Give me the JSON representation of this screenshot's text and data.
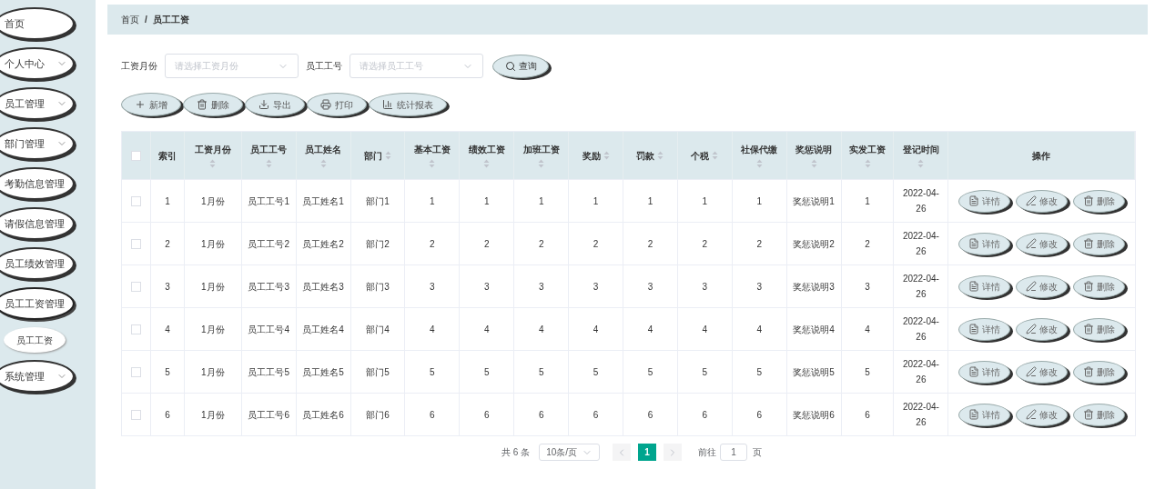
{
  "sidebar": {
    "items": [
      {
        "label": "首页",
        "collapsible": false,
        "expanded": false
      },
      {
        "label": "个人中心",
        "collapsible": true,
        "expanded": false
      },
      {
        "label": "员工管理",
        "collapsible": true,
        "expanded": false
      },
      {
        "label": "部门管理",
        "collapsible": true,
        "expanded": false
      },
      {
        "label": "考勤信息管理",
        "collapsible": false,
        "expanded": false
      },
      {
        "label": "请假信息管理",
        "collapsible": false,
        "expanded": false
      },
      {
        "label": "员工绩效管理",
        "collapsible": false,
        "expanded": false
      },
      {
        "label": "员工工资管理",
        "collapsible": false,
        "expanded": true,
        "children": [
          {
            "label": "员工工资",
            "selected": true
          }
        ]
      },
      {
        "label": "系统管理",
        "collapsible": true,
        "expanded": false
      }
    ]
  },
  "breadcrumb": {
    "items": [
      "首页",
      "员工工资"
    ],
    "separator": "/"
  },
  "filters": [
    {
      "label": "工资月份",
      "placeholder": "请选择工资月份"
    },
    {
      "label": "员工工号",
      "placeholder": "请选择员工工号"
    }
  ],
  "search_button": "查询",
  "toolbar": [
    {
      "label": "新增",
      "kind": "plus"
    },
    {
      "label": "删除",
      "kind": "trash"
    },
    {
      "label": "导出",
      "kind": "download"
    },
    {
      "label": "打印",
      "kind": "printer"
    },
    {
      "label": "统计报表",
      "kind": "chart"
    }
  ],
  "table": {
    "select_all_checked": false,
    "columns": [
      {
        "label": "索引",
        "sortable": false,
        "kind": "inline"
      },
      {
        "label": "工资月份",
        "sortable": true,
        "kind": "stacked"
      },
      {
        "label": "员工工号",
        "sortable": true,
        "kind": "stacked"
      },
      {
        "label": "员工姓名",
        "sortable": true,
        "kind": "stacked"
      },
      {
        "label": "部门",
        "sortable": true,
        "kind": "inline"
      },
      {
        "label": "基本工资",
        "sortable": true,
        "kind": "stacked"
      },
      {
        "label": "绩效工资",
        "sortable": true,
        "kind": "stacked"
      },
      {
        "label": "加班工资",
        "sortable": true,
        "kind": "stacked"
      },
      {
        "label": "奖励",
        "sortable": true,
        "kind": "inline"
      },
      {
        "label": "罚款",
        "sortable": true,
        "kind": "inline"
      },
      {
        "label": "个税",
        "sortable": true,
        "kind": "inline"
      },
      {
        "label": "社保代缴",
        "sortable": true,
        "kind": "stacked"
      },
      {
        "label": "奖惩说明",
        "sortable": true,
        "kind": "stacked"
      },
      {
        "label": "实发工资",
        "sortable": true,
        "kind": "stacked"
      },
      {
        "label": "登记时间",
        "sortable": true,
        "kind": "stacked"
      },
      {
        "label": "操作",
        "sortable": false,
        "kind": "inline"
      }
    ],
    "rows": [
      {
        "checked": false,
        "cells": [
          "1",
          "1月份",
          "员工工号1",
          "员工姓名1",
          "部门1",
          "1",
          "1",
          "1",
          "1",
          "1",
          "1",
          "1",
          "奖惩说明1",
          "1",
          "2022-04-26"
        ],
        "actions": [
          {
            "label": "详情",
            "kind": "doc"
          },
          {
            "label": "修改",
            "kind": "pen"
          },
          {
            "label": "删除",
            "kind": "trash"
          }
        ]
      },
      {
        "checked": false,
        "cells": [
          "2",
          "1月份",
          "员工工号2",
          "员工姓名2",
          "部门2",
          "2",
          "2",
          "2",
          "2",
          "2",
          "2",
          "2",
          "奖惩说明2",
          "2",
          "2022-04-26"
        ],
        "actions": [
          {
            "label": "详情",
            "kind": "doc"
          },
          {
            "label": "修改",
            "kind": "pen"
          },
          {
            "label": "删除",
            "kind": "trash"
          }
        ]
      },
      {
        "checked": false,
        "cells": [
          "3",
          "1月份",
          "员工工号3",
          "员工姓名3",
          "部门3",
          "3",
          "3",
          "3",
          "3",
          "3",
          "3",
          "3",
          "奖惩说明3",
          "3",
          "2022-04-26"
        ],
        "actions": [
          {
            "label": "详情",
            "kind": "doc"
          },
          {
            "label": "修改",
            "kind": "pen"
          },
          {
            "label": "删除",
            "kind": "trash"
          }
        ]
      },
      {
        "checked": false,
        "cells": [
          "4",
          "1月份",
          "员工工号4",
          "员工姓名4",
          "部门4",
          "4",
          "4",
          "4",
          "4",
          "4",
          "4",
          "4",
          "奖惩说明4",
          "4",
          "2022-04-26"
        ],
        "actions": [
          {
            "label": "详情",
            "kind": "doc"
          },
          {
            "label": "修改",
            "kind": "pen"
          },
          {
            "label": "删除",
            "kind": "trash"
          }
        ]
      },
      {
        "checked": false,
        "cells": [
          "5",
          "1月份",
          "员工工号5",
          "员工姓名5",
          "部门5",
          "5",
          "5",
          "5",
          "5",
          "5",
          "5",
          "5",
          "奖惩说明5",
          "5",
          "2022-04-26"
        ],
        "actions": [
          {
            "label": "详情",
            "kind": "doc"
          },
          {
            "label": "修改",
            "kind": "pen"
          },
          {
            "label": "删除",
            "kind": "trash"
          }
        ]
      },
      {
        "checked": false,
        "cells": [
          "6",
          "1月份",
          "员工工号6",
          "员工姓名6",
          "部门6",
          "6",
          "6",
          "6",
          "6",
          "6",
          "6",
          "6",
          "奖惩说明6",
          "6",
          "2022-04-26"
        ],
        "actions": [
          {
            "label": "详情",
            "kind": "doc"
          },
          {
            "label": "修改",
            "kind": "pen"
          },
          {
            "label": "删除",
            "kind": "trash"
          }
        ]
      }
    ]
  },
  "pagination": {
    "total": "共 6 条",
    "page_size": "10条/页",
    "pages": [
      {
        "label": "1",
        "selected": true
      }
    ],
    "goto_label": "前往",
    "goto_value": "1",
    "goto_suffix": "页"
  }
}
